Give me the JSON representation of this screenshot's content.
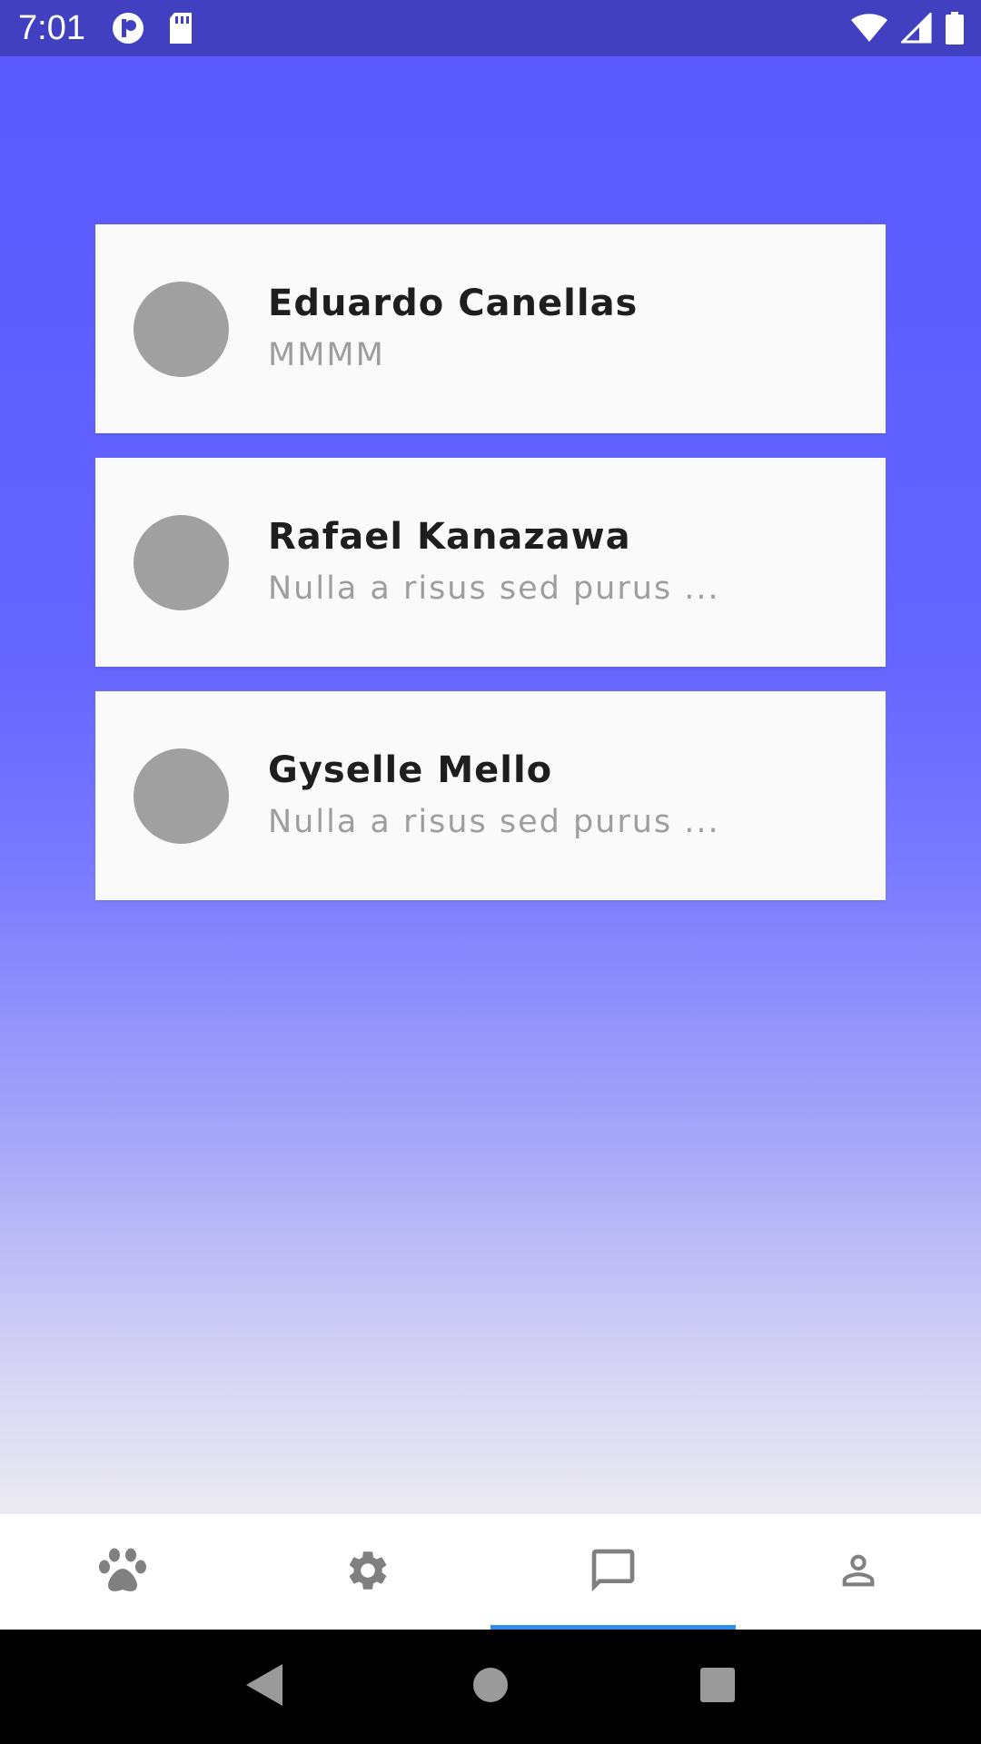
{
  "status_bar": {
    "time": "7:01",
    "background": "#4040c0",
    "left_icons": [
      "app-notification-icon",
      "sd-card-icon"
    ],
    "right_icons": [
      "wifi-icon",
      "cellular-signal-icon",
      "battery-icon"
    ]
  },
  "conversations": [
    {
      "name": "Eduardo Canellas",
      "preview": "MMMM"
    },
    {
      "name": "Rafael Kanazawa",
      "preview": "Nulla a risus sed purus ..."
    },
    {
      "name": "Gyselle Mello",
      "preview": "Nulla a risus sed purus ..."
    }
  ],
  "bottom_nav": {
    "tabs": [
      {
        "icon": "paw-icon",
        "active": false
      },
      {
        "icon": "gear-icon",
        "active": false
      },
      {
        "icon": "chat-icon",
        "active": true
      },
      {
        "icon": "person-icon",
        "active": false
      }
    ],
    "active_indicator_color": "#2f8ee8"
  },
  "system_nav": [
    "back-icon",
    "home-icon",
    "recents-icon"
  ],
  "colors": {
    "gradient_top": "#5a5aff",
    "gradient_bottom": "#ecebf2",
    "card": "#fafafa",
    "avatar_placeholder": "#a0a0a0",
    "name_text": "#1e1e1e",
    "preview_text": "#9e9e9e"
  }
}
